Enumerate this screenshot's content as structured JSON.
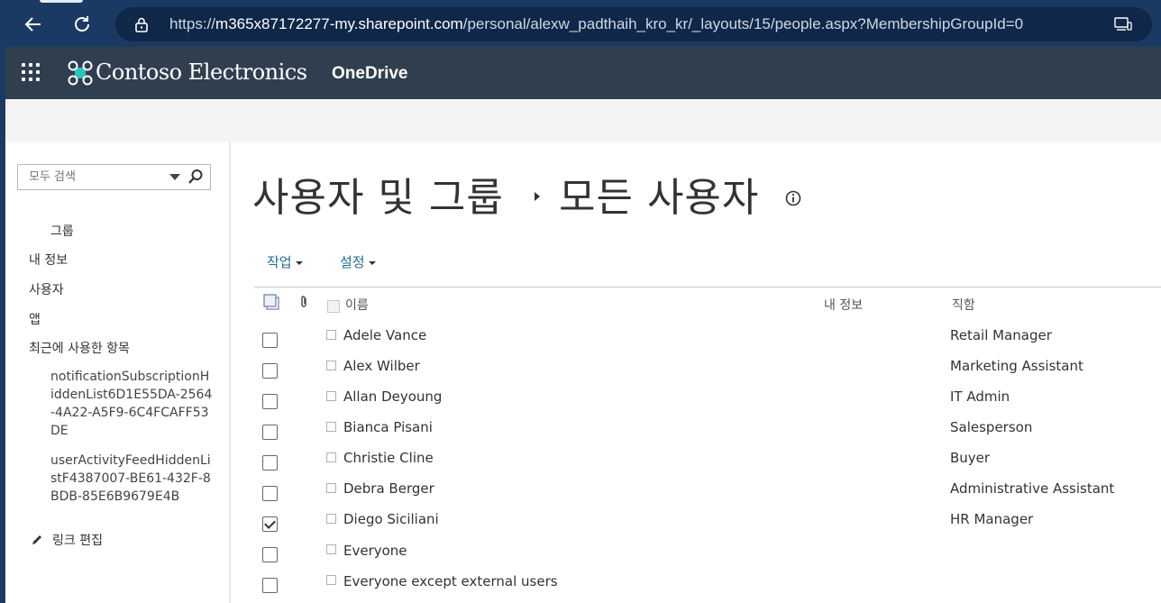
{
  "browser": {
    "url_prefix": "https://",
    "url_host": "m365x87172277-my.sharepoint.com",
    "url_path": "/personal/alexw_padthaih_kro_kr/_layouts/15/people.aspx?MembershipGroupId=0"
  },
  "suite": {
    "brand": "Contoso Electronics",
    "app": "OneDrive"
  },
  "search": {
    "placeholder": "모두 검색"
  },
  "nav": {
    "groups": "그룹",
    "my_info": "내 정보",
    "people": "사용자",
    "apps": "앱",
    "recent": "최근에 사용한 항목",
    "recent_items": [
      "notificationSubscriptionHiddenList6D1E55DA-2564-4A22-A5F9-6C4FCAFF53DE",
      "userActivityFeedHiddenListF4387007-BE61-432F-8BDB-85E6B9679E4B"
    ],
    "edit_links": "링크 편집"
  },
  "page": {
    "title_part1": "사용자 및 그룹",
    "title_part2": "모든 사용자"
  },
  "toolbar": {
    "actions": "작업",
    "settings": "설정"
  },
  "table": {
    "col_name": "이름",
    "col_about": "내 정보",
    "col_title": "직함",
    "rows": [
      {
        "name": "Adele Vance",
        "title": "Retail Manager",
        "checked": false
      },
      {
        "name": "Alex Wilber",
        "title": "Marketing Assistant",
        "checked": false
      },
      {
        "name": "Allan Deyoung",
        "title": "IT Admin",
        "checked": false
      },
      {
        "name": "Bianca Pisani",
        "title": "Salesperson",
        "checked": false
      },
      {
        "name": "Christie Cline",
        "title": "Buyer",
        "checked": false
      },
      {
        "name": "Debra Berger",
        "title": "Administrative Assistant",
        "checked": false
      },
      {
        "name": "Diego Siciliani",
        "title": "HR Manager",
        "checked": true
      },
      {
        "name": "Everyone",
        "title": "",
        "checked": false
      },
      {
        "name": "Everyone except external users",
        "title": "",
        "checked": false
      }
    ]
  },
  "colors": {
    "browser_bar": "#1b3a63",
    "suite_bar": "#2f3f4f",
    "link": "#1e6e8e"
  }
}
